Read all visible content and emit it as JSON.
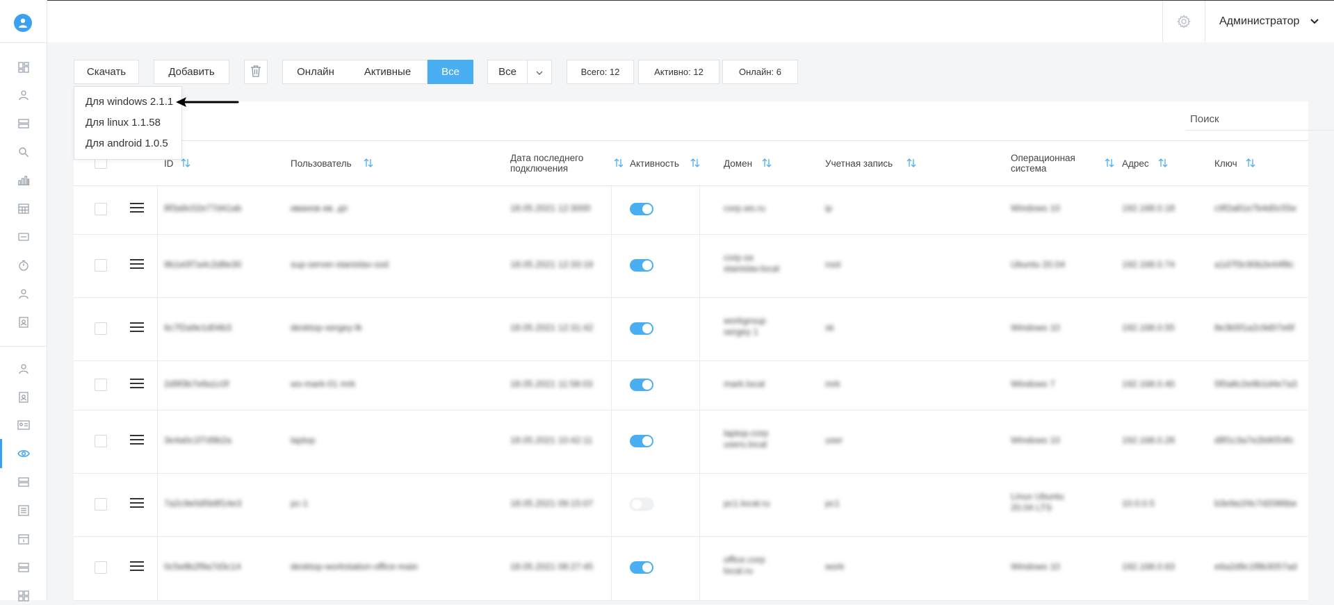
{
  "header": {
    "user_name": "Администратор"
  },
  "toolbar": {
    "download": "Скачать",
    "add": "Добавить",
    "filter_tabs": [
      "Онлайн",
      "Активные",
      "Все"
    ],
    "active_tab": "Все",
    "select_value": "Все",
    "stats": {
      "total": "Всего: 12",
      "active": "Активно: 12",
      "online": "Онлайн: 6"
    }
  },
  "download_menu": [
    "Для windows 2.1.1",
    "Для linux 1.1.58",
    "Для android 1.0.5"
  ],
  "search": {
    "placeholder": "Поиск"
  },
  "columns": {
    "id": "ID",
    "user": "Пользователь",
    "last_conn": [
      "Дата последнего",
      "подключения"
    ],
    "activity": "Активность",
    "domain": "Домен",
    "account": "Учетная запись",
    "os": [
      "Операционная",
      "система"
    ],
    "address": "Адрес",
    "key": "Ключ"
  },
  "rows": [
    {
      "active": true
    },
    {
      "active": true
    },
    {
      "active": true
    },
    {
      "active": true
    },
    {
      "active": true
    },
    {
      "active": false
    },
    {
      "active": true
    }
  ],
  "colors": {
    "accent": "#4aaef3",
    "sidebar_active": "#3aa0f0"
  },
  "sidebar_icons": [
    "dashboard-icon",
    "user-icon",
    "server-icon",
    "search-icon",
    "chart-icon",
    "calendar-icon",
    "card-icon",
    "timer-icon",
    "user-icon",
    "contact-icon",
    "user-icon",
    "contact-icon",
    "id-card-icon",
    "eye-icon",
    "server-icon",
    "list-icon",
    "calendar-icon",
    "server-icon",
    "dashboard-icon"
  ]
}
